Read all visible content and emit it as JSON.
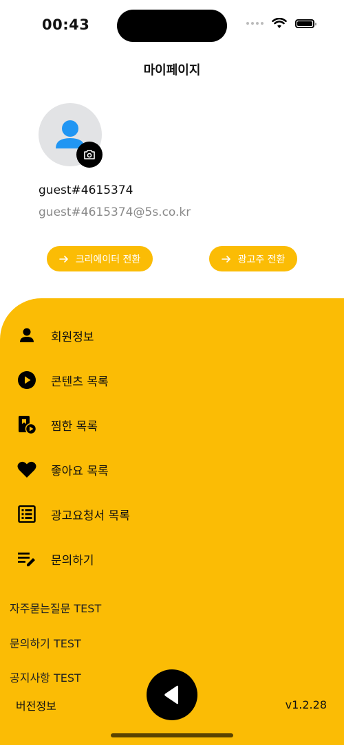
{
  "status_bar": {
    "time": "00:43"
  },
  "page": {
    "title": "마이페이지"
  },
  "profile": {
    "username": "guest#4615374",
    "email": "guest#4615374@5s.co.kr"
  },
  "actions": {
    "creator_switch": "크리에이터 전환",
    "advertiser_switch": "광고주 전환"
  },
  "menu": {
    "items": [
      {
        "label": "회원정보",
        "icon": "person-icon"
      },
      {
        "label": "콘텐츠 목록",
        "icon": "play-circle-icon"
      },
      {
        "label": "찜한 목록",
        "icon": "bookmark-play-icon"
      },
      {
        "label": "좋아요 목록",
        "icon": "heart-icon"
      },
      {
        "label": "광고요청서 목록",
        "icon": "list-icon"
      },
      {
        "label": "문의하기",
        "icon": "edit-note-icon"
      }
    ],
    "test_links": [
      "자주묻는질문 TEST",
      "문의하기 TEST",
      "공지사항 TEST"
    ]
  },
  "footer": {
    "version_label": "버전정보",
    "version": "v1.2.28"
  },
  "colors": {
    "accent": "#fbbc05",
    "avatar_icon": "#2196f3",
    "dark": "#000000"
  }
}
